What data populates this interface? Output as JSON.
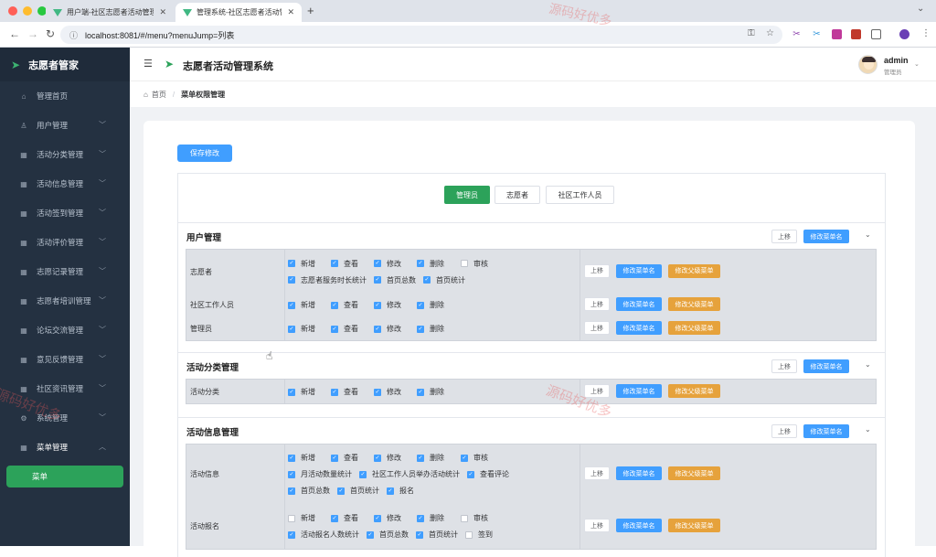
{
  "browser": {
    "tabs": [
      {
        "title": "用户端-社区志愿者活动管理系统"
      },
      {
        "title": "管理系统-社区志愿者活动管理系统"
      }
    ],
    "url": "localhost:8081/#/menu?menuJump=列表"
  },
  "sidebar": {
    "brand": "志愿者管家",
    "items": [
      {
        "label": "管理首页",
        "icon": "home-icon",
        "glyph": "⌂"
      },
      {
        "label": "用户管理",
        "icon": "user-icon",
        "glyph": "♙"
      },
      {
        "label": "活动分类管理",
        "icon": "grid-icon",
        "glyph": "▦"
      },
      {
        "label": "活动信息管理",
        "icon": "grid-icon",
        "glyph": "▦"
      },
      {
        "label": "活动签到管理",
        "icon": "grid-icon",
        "glyph": "▦"
      },
      {
        "label": "活动评价管理",
        "icon": "grid-icon",
        "glyph": "▦"
      },
      {
        "label": "志愿记录管理",
        "icon": "grid-icon",
        "glyph": "▦"
      },
      {
        "label": "志愿者培训管理",
        "icon": "grid-icon",
        "glyph": "▦"
      },
      {
        "label": "论坛交流管理",
        "icon": "grid-icon",
        "glyph": "▦"
      },
      {
        "label": "意见反馈管理",
        "icon": "grid-icon",
        "glyph": "▦"
      },
      {
        "label": "社区资讯管理",
        "icon": "grid-icon",
        "glyph": "▦"
      },
      {
        "label": "系统管理",
        "icon": "gear-icon",
        "glyph": "⚙"
      },
      {
        "label": "菜单管理",
        "icon": "grid-icon",
        "glyph": "▦"
      }
    ],
    "sub_active": "菜单"
  },
  "header": {
    "title": "志愿者活动管理系统",
    "user": {
      "name": "admin",
      "role": "管理员"
    }
  },
  "breadcrumb": {
    "home": "首页",
    "current": "菜单权限管理"
  },
  "main": {
    "save_label": "保存修改",
    "role_tabs": [
      "管理员",
      "志愿者",
      "社区工作人员"
    ],
    "buttons": {
      "up": "上移",
      "rename": "修改菜单名",
      "parent": "修改父级菜单"
    },
    "sections": [
      {
        "title": "用户管理",
        "rows": [
          {
            "label": "志愿者",
            "perms": [
              {
                "name": "新增",
                "on": true
              },
              {
                "name": "查看",
                "on": true
              },
              {
                "name": "修改",
                "on": true
              },
              {
                "name": "删除",
                "on": true
              },
              {
                "name": "审核",
                "on": false
              },
              {
                "name": "志愿者服务时长统计",
                "on": true
              },
              {
                "name": "首页总数",
                "on": true
              },
              {
                "name": "首页统计",
                "on": true
              }
            ]
          },
          {
            "label": "社区工作人员",
            "perms": [
              {
                "name": "新增",
                "on": true
              },
              {
                "name": "查看",
                "on": true
              },
              {
                "name": "修改",
                "on": true
              },
              {
                "name": "删除",
                "on": true
              }
            ]
          },
          {
            "label": "管理员",
            "perms": [
              {
                "name": "新增",
                "on": true
              },
              {
                "name": "查看",
                "on": true
              },
              {
                "name": "修改",
                "on": true
              },
              {
                "name": "删除",
                "on": true
              }
            ]
          }
        ]
      },
      {
        "title": "活动分类管理",
        "rows": [
          {
            "label": "活动分类",
            "perms": [
              {
                "name": "新增",
                "on": true
              },
              {
                "name": "查看",
                "on": true
              },
              {
                "name": "修改",
                "on": true
              },
              {
                "name": "删除",
                "on": true
              }
            ]
          }
        ]
      },
      {
        "title": "活动信息管理",
        "rows": [
          {
            "label": "活动信息",
            "perms": [
              {
                "name": "新增",
                "on": true
              },
              {
                "name": "查看",
                "on": true
              },
              {
                "name": "修改",
                "on": true
              },
              {
                "name": "删除",
                "on": true
              },
              {
                "name": "审核",
                "on": true
              },
              {
                "name": "月活动数量统计",
                "on": true
              },
              {
                "name": "社区工作人员举办活动统计",
                "on": true
              },
              {
                "name": "查看评论",
                "on": true
              },
              {
                "name": "首页总数",
                "on": true
              },
              {
                "name": "首页统计",
                "on": true
              },
              {
                "name": "报名",
                "on": true
              }
            ]
          },
          {
            "label": "活动报名",
            "perms": [
              {
                "name": "新增",
                "on": false
              },
              {
                "name": "查看",
                "on": true
              },
              {
                "name": "修改",
                "on": true
              },
              {
                "name": "删除",
                "on": true
              },
              {
                "name": "审核",
                "on": false
              },
              {
                "name": "活动报名人数统计",
                "on": true
              },
              {
                "name": "首页总数",
                "on": true
              },
              {
                "name": "首页统计",
                "on": true
              },
              {
                "name": "签到",
                "on": false
              }
            ]
          }
        ]
      }
    ]
  },
  "watermark": "源码好优多"
}
